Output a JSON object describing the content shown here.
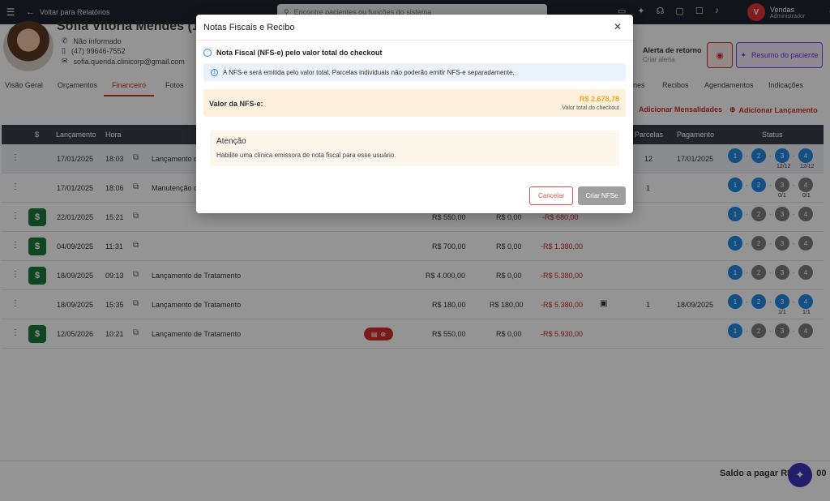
{
  "topbar": {
    "back_label": "Voltar para Relatórios",
    "search_placeholder": "Encontre pacientes ou funções do sistema",
    "user_initial": "V",
    "user_name": "Vendas",
    "user_role": "Administrador"
  },
  "patient": {
    "name": "Sofia Vitória Mendes (112",
    "field_1": "Não informado",
    "phone": "(47) 99646-7552",
    "email": "sofia.querida.clinicorp@gmail.com",
    "return_title": "Alerta de retorno",
    "return_sub": "Criar alerta",
    "summary_button": "Resumo do paciente"
  },
  "tabs": [
    {
      "label": "Visão Geral"
    },
    {
      "label": "Orçamentos"
    },
    {
      "label": "Financeiro"
    },
    {
      "label": "Fotos"
    },
    {
      "label": "nes"
    },
    {
      "label": "Recibos"
    },
    {
      "label": "Agendamentos"
    },
    {
      "label": "Indicações"
    }
  ],
  "actions": {
    "mensalidades": "Adicionar Mensalidades",
    "lancamento": "Adicionar Lançamento"
  },
  "table": {
    "headers": [
      "$",
      "Lançamento",
      "Hora",
      "Parcelas",
      "Pagamento",
      "Status"
    ],
    "rows": [
      {
        "date": "17/01/2025",
        "time": "18:03",
        "desc": "Lançamento d",
        "v1": "",
        "v2": "",
        "v3": "",
        "parcelas": "12",
        "pagamento": "17/01/2025",
        "s3": "12/12",
        "s4": "12/12"
      },
      {
        "date": "17/01/2025",
        "time": "18:06",
        "desc": "Manutenção o",
        "v1": "",
        "v2": "",
        "v3": "",
        "parcelas": "1",
        "pagamento": "",
        "s3": "0/1",
        "s4": "0/1"
      },
      {
        "date": "22/01/2025",
        "time": "15:21",
        "desc": "",
        "v1": "R$ 550,00",
        "v2": "R$ 0,00",
        "v3": "-R$ 680,00",
        "parcelas": "",
        "pagamento": ""
      },
      {
        "date": "04/09/2025",
        "time": "11:31",
        "desc": "",
        "v1": "R$ 700,00",
        "v2": "R$ 0,00",
        "v3": "-R$ 1.380,00",
        "parcelas": "",
        "pagamento": ""
      },
      {
        "date": "18/09/2025",
        "time": "09:13",
        "desc": "Lançamento de Tratamento",
        "v1": "R$ 4.000,00",
        "v2": "R$ 0,00",
        "v3": "-R$ 5.380,00",
        "parcelas": "",
        "pagamento": ""
      },
      {
        "date": "18/09/2025",
        "time": "15:35",
        "desc": "Lançamento de Tratamento",
        "v1": "R$ 180,00",
        "v2": "R$ 180,00",
        "v3": "-R$ 5.380,00",
        "parcelas": "1",
        "pagamento": "18/09/2025",
        "s3": "1/1",
        "s4": "1/1"
      },
      {
        "date": "12/05/2026",
        "time": "10:21",
        "desc": "Lançamento de Tratamento",
        "v1": "R$ 550,00",
        "v2": "R$ 0,00",
        "v3": "-R$ 5.930,00",
        "parcelas": "",
        "pagamento": ""
      }
    ]
  },
  "footer": {
    "saldo": "Saldo a pagar R$",
    "saldo_tail": "00"
  },
  "modal": {
    "title": "Notas Fiscais e Recibo",
    "subtitle": "Nota Fiscal (NFS-e) pelo valor total do checkout",
    "info": "A NFS-e será emitida pelo valor total. Parcelas individuais não poderão emitir NFS-e separadamente.",
    "nfse_label": "Valor da NFS-e:",
    "nfse_value": "R$ 2.678,78",
    "nfse_sub": "Valor total do checkout",
    "attention_title": "Atenção",
    "attention_text": "Habilite uma clínica emissora de nota fiscal para esse usuário.",
    "cancel": "Cancelar",
    "create": "Criar NFSe"
  },
  "colors": {
    "accent": "#c33333",
    "step_blue": "#1e88e5",
    "step_gray": "#7d7d7d",
    "money_green": "#1a7a37",
    "purple": "#6a33e0"
  }
}
